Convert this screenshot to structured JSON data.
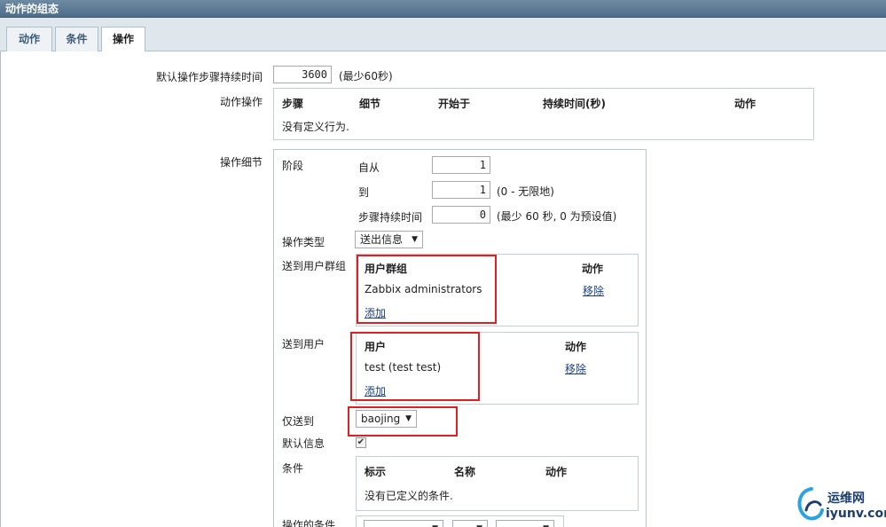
{
  "window": {
    "title": "动作的组态"
  },
  "tabs": [
    {
      "label": "动作"
    },
    {
      "label": "条件"
    },
    {
      "label": "操作"
    }
  ],
  "default_step_duration": {
    "label": "默认操作步骤持续时间",
    "value": "3600",
    "hint": "(最少60秒)"
  },
  "action_operations": {
    "label": "动作操作",
    "columns": [
      "步骤",
      "细节",
      "开始于",
      "持续时间(秒)",
      "动作"
    ],
    "empty_text": "没有定义行为."
  },
  "operation_details": {
    "label": "操作细节",
    "steps_label": "阶段",
    "from_label": "自从",
    "from_value": "1",
    "to_label": "到",
    "to_value": "1",
    "to_hint": "(0 - 无限地)",
    "step_duration_label": "步骤持续时间",
    "step_duration_value": "0",
    "step_duration_hint": "(最少 60 秒, 0 为预设值)",
    "op_type_label": "操作类型",
    "op_type_value": "送出信息",
    "send_groups_label": "送到用户群组",
    "groups_col_group": "用户群组",
    "groups_col_action": "动作",
    "group_name": "Zabbix administrators",
    "group_remove": "移除",
    "group_add": "添加",
    "send_users_label": "送到用户",
    "users_col_user": "用户",
    "users_col_action": "动作",
    "user_name": "test (test test)",
    "user_remove": "移除",
    "user_add": "添加",
    "send_only_label": "仅送到",
    "send_only_value": "baojing",
    "default_msg_label": "默认信息",
    "default_msg_checked": true,
    "conditions_label": "条件",
    "cond_col_label": "标示",
    "cond_col_name": "名称",
    "cond_col_action": "动作",
    "cond_empty": "没有已定义的条件.",
    "op_conditions_label": "操作的条件"
  },
  "watermark": {
    "line1": "运维网",
    "line2": "iyunv.com"
  },
  "colors": {
    "highlight": "#e02020",
    "link": "#1a3f80",
    "titlebar": "#4d6c88"
  }
}
